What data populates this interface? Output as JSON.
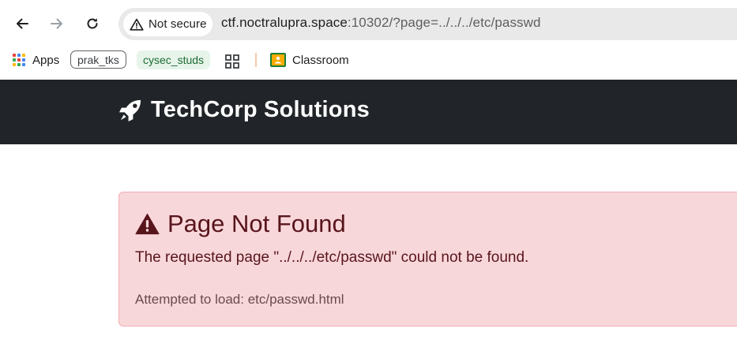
{
  "browser": {
    "security_label": "Not secure",
    "url_host": "ctf.noctralupra.space",
    "url_rest": ":10302/?page=../../../etc/passwd",
    "icons": [
      "back-icon",
      "forward-icon",
      "reload-icon",
      "warning-icon"
    ]
  },
  "bookmarks": {
    "apps_label": "Apps",
    "items": [
      {
        "label": "prak_tks"
      },
      {
        "label": "cysec_studs"
      },
      {
        "label": "Classroom"
      }
    ]
  },
  "site": {
    "brand": "TechCorp Solutions",
    "brand_icon": "rocket-icon"
  },
  "alert": {
    "title": "Page Not Found",
    "message": "The requested page \"../../../etc/passwd\" could not be found.",
    "note": "Attempted to load: etc/passwd.html",
    "colors": {
      "background": "#f8d7da",
      "text": "#58151c",
      "border": "#f1aeb5"
    }
  }
}
